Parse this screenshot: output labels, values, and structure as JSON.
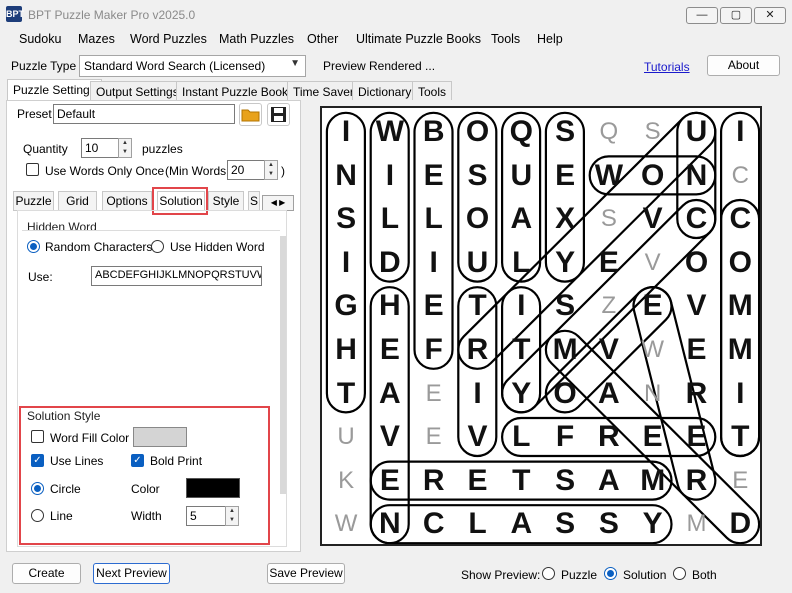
{
  "window": {
    "title": "BPT Puzzle Maker Pro v2025.0",
    "icon_text": "BPT",
    "min": "—",
    "max": "▢",
    "close": "✕"
  },
  "menu": [
    "Sudoku",
    "Mazes",
    "Word Puzzles",
    "Math Puzzles",
    "Other",
    "Ultimate Puzzle Books",
    "Tools",
    "Help"
  ],
  "toolbar": {
    "type_label": "Puzzle Type",
    "type_value": "Standard Word Search (Licensed)",
    "preview_status": "Preview Rendered ...",
    "tutorials": "Tutorials",
    "about": "About"
  },
  "tabs": [
    "Puzzle Settings",
    "Output Settings",
    "Instant Puzzle Books",
    "Time Saver",
    "Dictionary",
    "Tools"
  ],
  "settings": {
    "preset_label": "Preset",
    "preset_value": "Default",
    "quantity_label": "Quantity",
    "quantity_value": "10",
    "quantity_unit": "puzzles",
    "use_once_label": "Use Words Only Once",
    "min_words_label": "(Min Words:",
    "min_words_value": "20",
    "min_words_close": ")",
    "subtabs": [
      "Puzzle",
      "Grid",
      "Options",
      "Solution",
      "Style",
      "S"
    ],
    "hidden_word_title": "Hidden Word",
    "random_chars": "Random Characters",
    "use_hidden": "Use Hidden Word",
    "use_label": "Use:",
    "use_value": "ABCDEFGHIJKLMNOPQRSTUVW",
    "solution_style_title": "Solution Style",
    "word_fill_color": "Word Fill Color",
    "use_lines": "Use Lines",
    "bold_print": "Bold Print",
    "circle": "Circle",
    "line": "Line",
    "color_label": "Color",
    "width_label": "Width",
    "width_value": "5",
    "fill_swatch": "#d4d4d4",
    "line_swatch": "#000000"
  },
  "bottom": {
    "create": "Create",
    "next_preview": "Next Preview",
    "save_preview": "Save Preview",
    "show_preview": "Show Preview:",
    "opt_puzzle": "Puzzle",
    "opt_solution": "Solution",
    "opt_both": "Both"
  },
  "grid": {
    "rows": [
      "IWBOQSQSUI",
      "NIESUEWONC",
      "SLLOAXSVCC",
      "IDIULYEVOO",
      "GHETISZEVM",
      "HEFRTMVWEM",
      "TAEIYOANRI",
      "UVEVLFREET",
      "KERETSAMRE",
      "WNCLASSYMD"
    ],
    "light": [
      [
        0,
        0,
        0,
        0,
        0,
        0,
        1,
        1,
        0,
        0
      ],
      [
        0,
        0,
        0,
        0,
        0,
        0,
        0,
        0,
        0,
        1
      ],
      [
        0,
        0,
        0,
        0,
        0,
        0,
        1,
        0,
        0,
        0
      ],
      [
        0,
        0,
        0,
        0,
        0,
        0,
        0,
        1,
        0,
        0
      ],
      [
        0,
        0,
        0,
        0,
        0,
        0,
        1,
        0,
        0,
        0
      ],
      [
        0,
        0,
        0,
        0,
        0,
        0,
        0,
        1,
        0,
        0
      ],
      [
        0,
        0,
        1,
        0,
        0,
        0,
        0,
        1,
        0,
        0
      ],
      [
        1,
        0,
        1,
        0,
        0,
        0,
        0,
        0,
        0,
        0
      ],
      [
        1,
        0,
        0,
        0,
        0,
        0,
        0,
        0,
        0,
        1
      ],
      [
        1,
        0,
        0,
        0,
        0,
        0,
        0,
        0,
        1,
        0
      ]
    ]
  }
}
